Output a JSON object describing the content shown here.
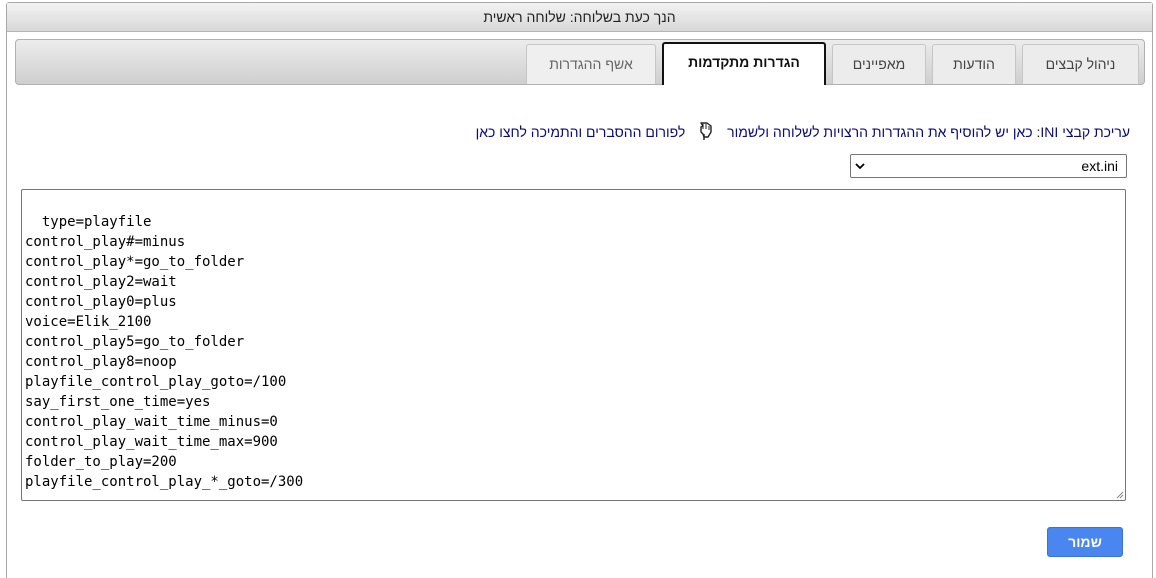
{
  "window": {
    "title": "הנך כעת בשלוחה: שלוחה ראשית"
  },
  "tabs": [
    {
      "label": "ניהול קבצים",
      "state": "normal"
    },
    {
      "label": "הודעות",
      "state": "normal"
    },
    {
      "label": "מאפיינים",
      "state": "normal"
    },
    {
      "label": "הגדרות מתקדמות",
      "state": "active"
    },
    {
      "label": "אשף ההגדרות",
      "state": "disabled"
    }
  ],
  "info": {
    "text": "עריכת קבצי INI: כאן יש להוסיף את ההגדרות הרצויות לשלוחה ולשמור",
    "icon": "pointing-hand-icon",
    "link_text": "לפורום ההסברים והתמיכה לחצו כאן"
  },
  "file_select": {
    "value": "ext.ini"
  },
  "editor": {
    "content": "type=playfile\ncontrol_play#=minus\ncontrol_play*=go_to_folder\ncontrol_play2=wait\ncontrol_play0=plus\nvoice=Elik_2100\ncontrol_play5=go_to_folder\ncontrol_play8=noop\nplayfile_control_play_goto=/100\nsay_first_one_time=yes\ncontrol_play_wait_time_minus=0\ncontrol_play_wait_time_max=900\nfolder_to_play=200\nplayfile_control_play_*_goto=/300"
  },
  "save_button": {
    "label": "שמור"
  },
  "colors": {
    "save_button": "#4a86ef",
    "info_text": "#0a0a78"
  }
}
